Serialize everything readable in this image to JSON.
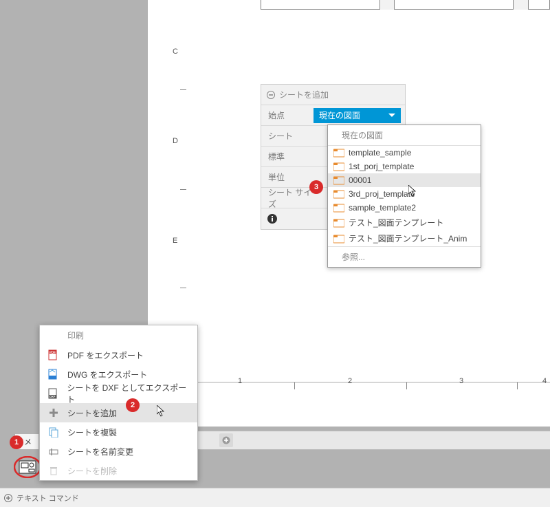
{
  "rows": {
    "c": "C",
    "d": "D",
    "e": "E"
  },
  "cols": {
    "c1": "1",
    "c2": "2",
    "c3": "3",
    "c4": "4"
  },
  "panel": {
    "title": "シートを追加",
    "labels": {
      "origin": "始点",
      "sheet": "シート",
      "standard": "標準",
      "unit": "単位",
      "sheet_size": "シート サイズ"
    },
    "selected_origin": "現在の図面"
  },
  "dropdown": {
    "head": "現在の図面",
    "items": [
      "template_sample",
      "1st_porj_template",
      "00001",
      "3rd_proj_template",
      "sample_template2",
      "テスト_図面テンプレート",
      "テスト_図面テンプレート_Anim"
    ],
    "browse": "参照..."
  },
  "context_menu": {
    "head": "印刷",
    "items": {
      "pdf": "PDF をエクスポート",
      "dwg": "DWG をエクスポート",
      "dxf": "シートを DXF としてエクスポート",
      "add": "シートを追加",
      "dup": "シートを複製",
      "ren": "シートを名前変更",
      "del": "シートを削除"
    }
  },
  "comment_label": "コメ",
  "status_text": "テキスト コマンド",
  "badges": {
    "b1": "1",
    "b2": "2",
    "b3": "3"
  }
}
